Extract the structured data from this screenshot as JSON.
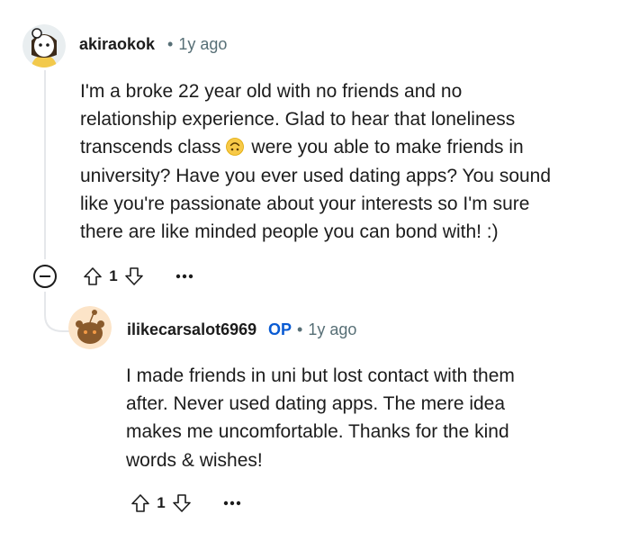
{
  "comment": {
    "username": "akiraokok",
    "separator": "•",
    "time": "1y ago",
    "lines": [
      "I'm a broke 22 year old with no friends and no",
      "relationship experience. Glad to hear that loneliness",
      "transcends class",
      "were you able to make friends in",
      "university? Have you ever used dating apps? You sound",
      "like you're passionate about your interests so I'm sure",
      "there are like minded people you can bond with! :)"
    ],
    "emoji_icon": "upside-down-face-emoji",
    "score": "1"
  },
  "reply": {
    "username": "ilikecarsalot6969",
    "op_badge": "OP",
    "separator": "•",
    "time": "1y ago",
    "lines": [
      "I made friends in uni but lost contact with them",
      "after. Never used dating apps. The mere idea",
      "makes me uncomfortable. Thanks for the kind",
      "words & wishes!"
    ],
    "score": "1"
  },
  "colors": {
    "text": "#1c1c1c",
    "meta": "#576f76",
    "op_badge": "#0a5bd3",
    "thread_line": "#e5e7ea"
  }
}
